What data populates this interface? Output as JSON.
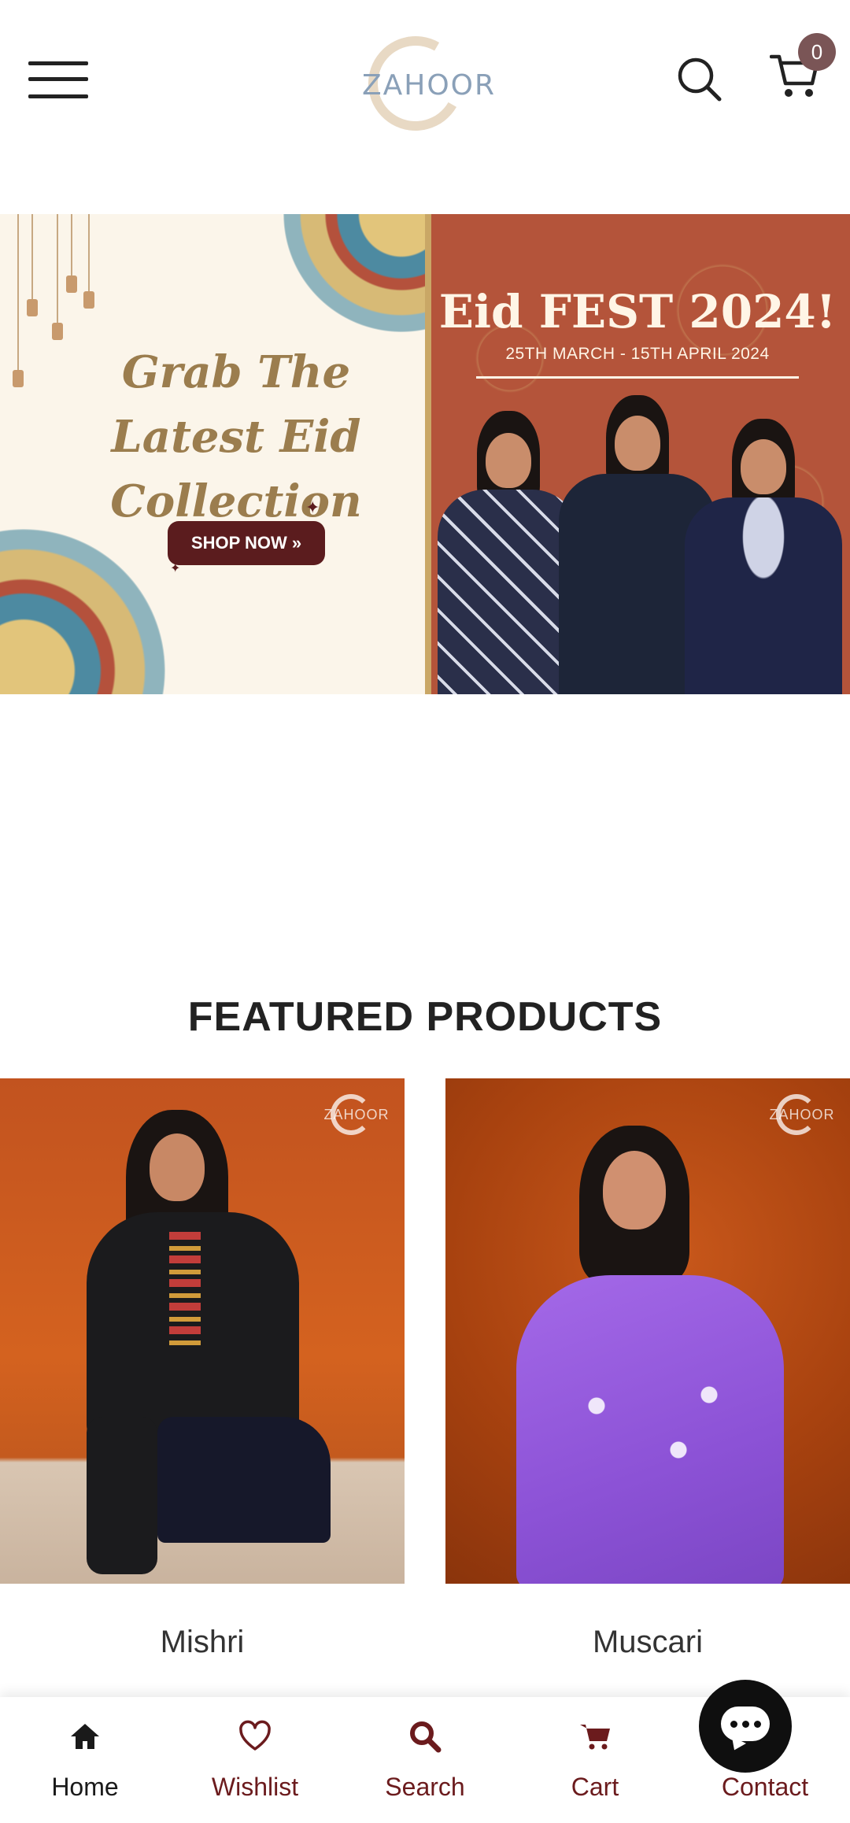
{
  "header": {
    "logo_text": "ZAHOOR",
    "cart_count": "0",
    "menu_icon": "hamburger-menu-icon",
    "search_icon": "search-icon",
    "cart_icon": "shopping-cart-icon"
  },
  "banner": {
    "left_title": "Grab The Latest Eid Collection",
    "shop_button": "SHOP NOW »",
    "right_title": "Eid FEST 2024!",
    "right_dates": "25TH MARCH - 15TH APRIL 2024"
  },
  "featured": {
    "title": "FEATURED PRODUCTS",
    "products": [
      {
        "name": "Mishri",
        "watermark": "ZAHOOR"
      },
      {
        "name": "Muscari",
        "watermark": "ZAHOOR"
      }
    ]
  },
  "bottom_nav": {
    "items": [
      {
        "label": "Home",
        "icon": "home-icon",
        "color": "#1a1a1a"
      },
      {
        "label": "Wishlist",
        "icon": "heart-icon",
        "color": "#6b1b1d"
      },
      {
        "label": "Search",
        "icon": "search-icon",
        "color": "#6b1b1d"
      },
      {
        "label": "Cart",
        "icon": "cart-icon",
        "color": "#6b1b1d"
      },
      {
        "label": "Contact",
        "icon": "chat-icon",
        "color": "#6b1b1d"
      }
    ]
  },
  "colors": {
    "accent_maroon": "#6b1b1d",
    "badge": "#7a5556",
    "banner_left_bg": "#fbf5ea",
    "banner_right_bg": "#b4543a"
  }
}
